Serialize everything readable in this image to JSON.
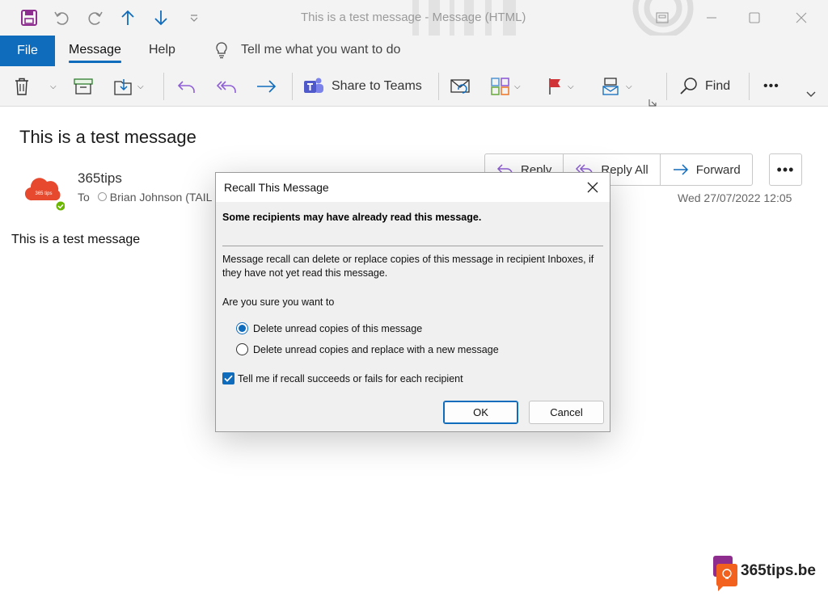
{
  "window": {
    "title": "This is a test message  -  Message (HTML)"
  },
  "ribbon": {
    "tabs": [
      {
        "label": "File"
      },
      {
        "label": "Message"
      },
      {
        "label": "Help"
      }
    ],
    "tell_me": "Tell me what you want to do",
    "share_to_teams": "Share to Teams",
    "find": "Find",
    "more": "•••"
  },
  "message": {
    "subject": "This is a test message",
    "sender": "365tips",
    "to_label": "To",
    "to_recipient": "Brian Johnson (TAIL",
    "date": "Wed 27/07/2022 12:05",
    "body": "This is a test message",
    "actions": {
      "reply": "Reply",
      "reply_all": "Reply All",
      "forward": "Forward",
      "more": "•••"
    },
    "avatar_text": "365 tips"
  },
  "dialog": {
    "title": "Recall This Message",
    "warning": "Some recipients may have already read this message.",
    "description": "Message recall can delete or replace copies of this message in recipient Inboxes, if they have not yet read this message.",
    "question": "Are you sure you want to",
    "options": [
      {
        "label": "Delete unread copies of this message",
        "selected": true
      },
      {
        "label": "Delete unread copies and replace with a new message",
        "selected": false
      }
    ],
    "checkbox": {
      "label": "Tell me if recall succeeds or fails for each recipient",
      "checked": true
    },
    "ok": "OK",
    "cancel": "Cancel"
  },
  "watermark": {
    "text": "365tips.be"
  },
  "colors": {
    "accent": "#0f6cbd",
    "purple": "#8f5fd6",
    "save_icon": "#8c2d8f",
    "flag": "#d13438"
  }
}
